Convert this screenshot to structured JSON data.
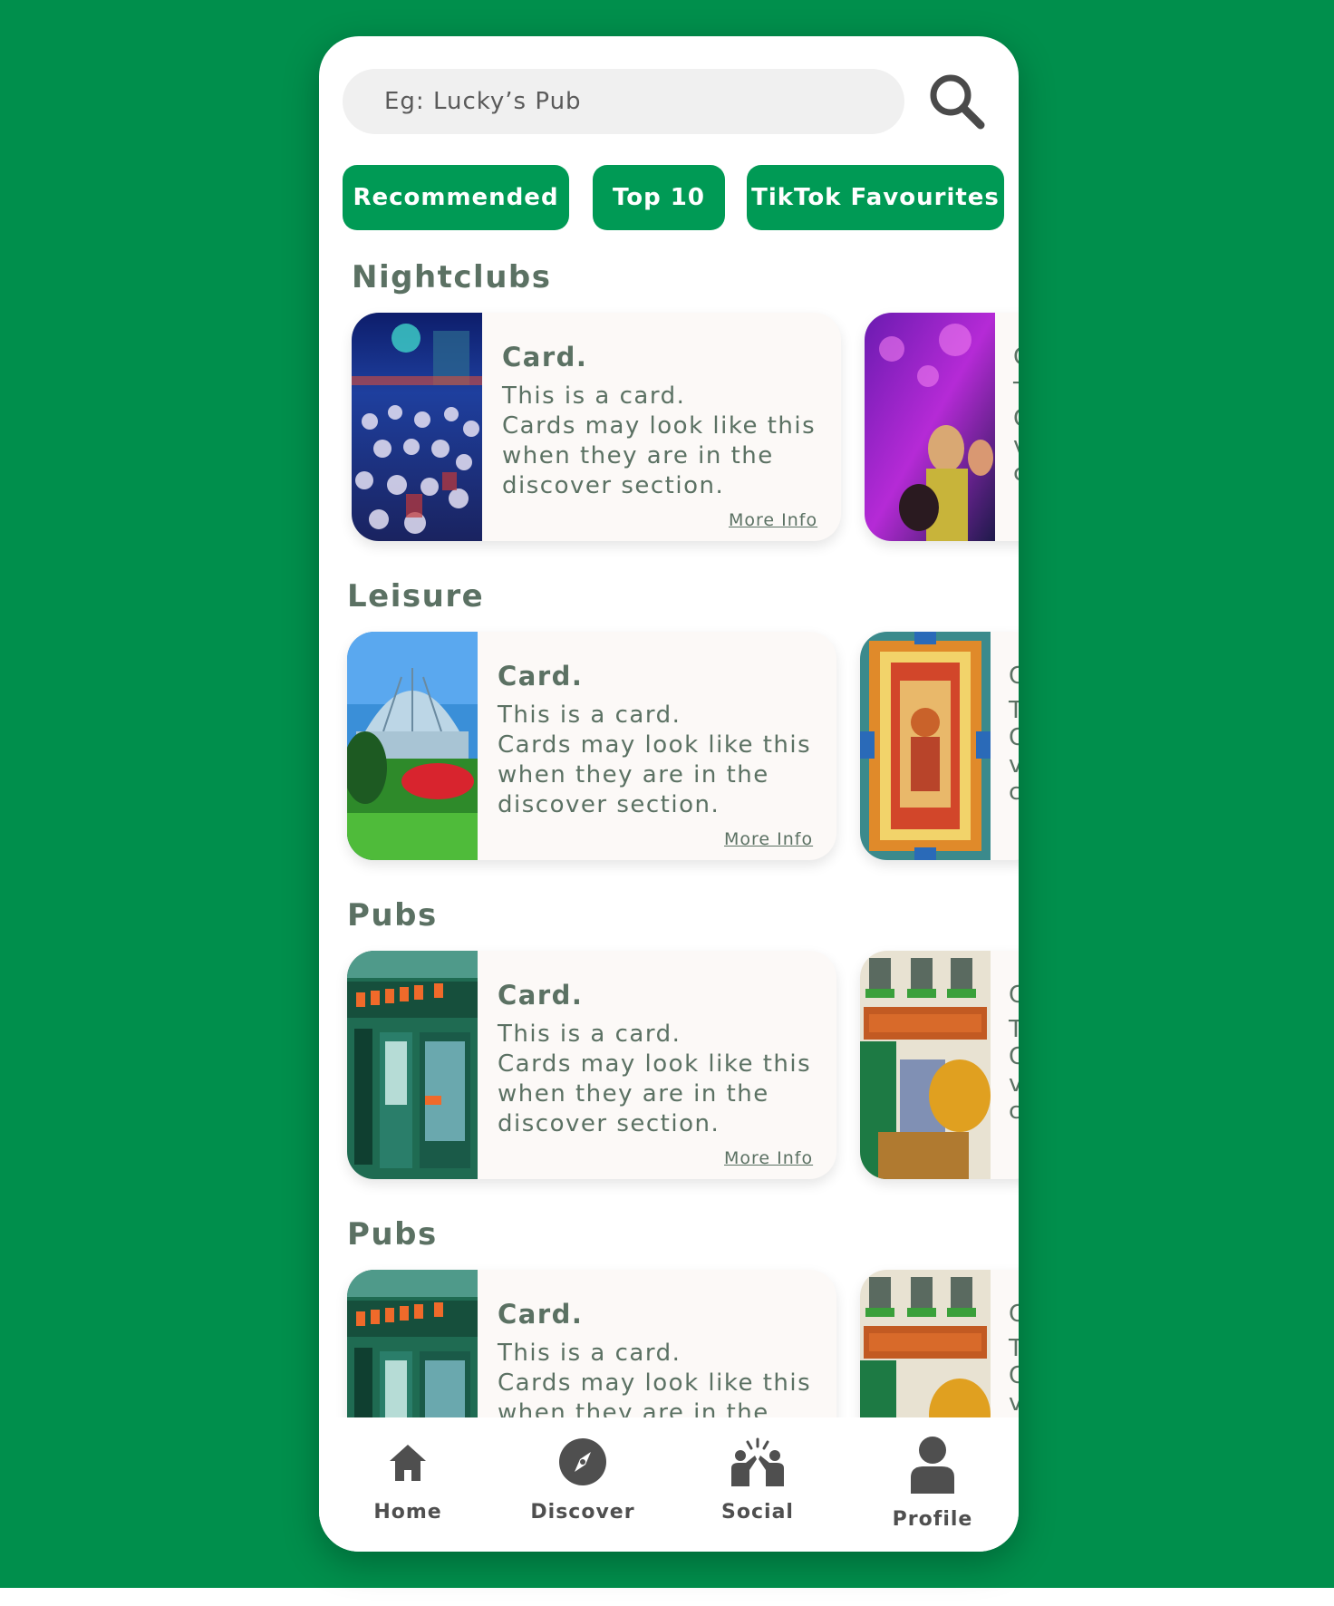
{
  "search": {
    "placeholder": "Eg: Lucky’s Pub",
    "icon": "search-icon"
  },
  "chips": [
    {
      "label": "Recommended"
    },
    {
      "label": "Top 10"
    },
    {
      "label": "TikTok Favourites"
    }
  ],
  "sections": [
    {
      "title": "Nightclubs",
      "card": {
        "title": "Card.",
        "body": "This is a card.\nCards may look like this\nwhen they are in the\ndiscover section.",
        "link": "More Info",
        "image": "nightclub-crowd-photo"
      },
      "peek": {
        "image": "nightclub-dancers-photo"
      }
    },
    {
      "title": "Leisure",
      "card": {
        "title": "Card.",
        "body": "This is a card.\nCards may look like this\nwhen they are in the\ndiscover section.",
        "link": "More Info",
        "image": "glasshouse-garden-photo"
      },
      "peek": {
        "image": "celtic-mosaic-photo"
      }
    },
    {
      "title": "Pubs",
      "card": {
        "title": "Card.",
        "body": "This is a card.\nCards may look like this\nwhen they are in the\ndiscover section.",
        "link": "More Info",
        "image": "luckys-pub-storefront-photo"
      },
      "peek": {
        "image": "johnnie-foxs-pub-photo"
      }
    },
    {
      "title": "Pubs",
      "card": {
        "title": "Card.",
        "body": "This is a card.\nCards may look like this\nwhen they are in the",
        "link": "",
        "image": "luckys-pub-storefront-photo"
      },
      "peek": {
        "image": "johnnie-foxs-pub-photo"
      }
    }
  ],
  "peek_letters": [
    "C",
    "T",
    "C",
    "v",
    "c"
  ],
  "nav": [
    {
      "label": "Home",
      "icon": "home-icon"
    },
    {
      "label": "Discover",
      "icon": "compass-icon"
    },
    {
      "label": "Social",
      "icon": "social-icon"
    },
    {
      "label": "Profile",
      "icon": "person-icon"
    }
  ],
  "colors": {
    "background": "#008f4c",
    "chip": "#009a55",
    "text": "#5b7163",
    "card": "#fcf9f7"
  }
}
